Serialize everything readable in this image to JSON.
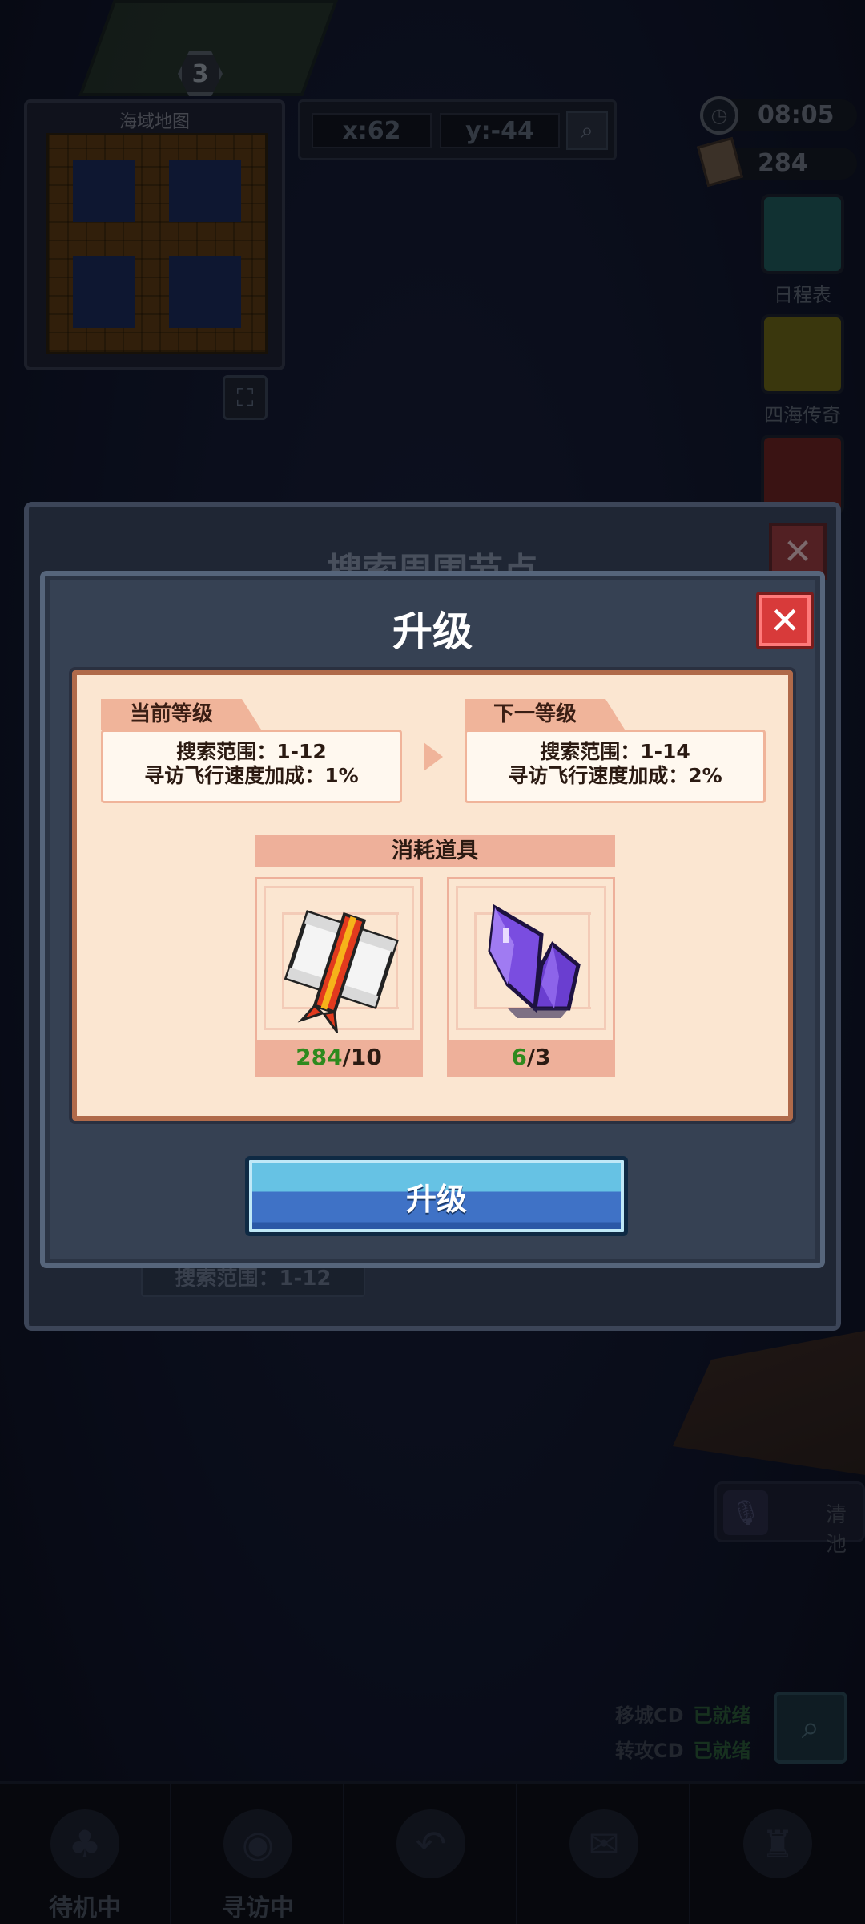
{
  "hud": {
    "base_level": "3",
    "minimap_title": "海域地图",
    "coord_x": "x:62",
    "coord_y": "y:-44",
    "clock": "08:05",
    "scroll_count": "284"
  },
  "side_buttons": [
    {
      "label": "日程表",
      "color": "#1f5a5c"
    },
    {
      "label": "四海传奇",
      "color": "#6b6518"
    },
    {
      "label": "",
      "color": "#6a2424"
    }
  ],
  "background_dialog": {
    "title": "搜索周围节点",
    "range_text": "搜索范围：1-12"
  },
  "upgrade_dialog": {
    "title": "升级",
    "current": {
      "tag": "当前等级",
      "range": "搜索范围：1-12",
      "speed": "寻访飞行速度加成：1%"
    },
    "next": {
      "tag": "下一等级",
      "range": "搜索范围：1-14",
      "speed": "寻访飞行速度加成：2%"
    },
    "consume_header": "消耗道具",
    "items": [
      {
        "name": "scroll-item",
        "have": "284",
        "need": "/10"
      },
      {
        "name": "crystal-item",
        "have": "6",
        "need": "/3"
      }
    ],
    "button": "升级"
  },
  "cooldowns": [
    {
      "label": "移城CD",
      "status": "已就绪"
    },
    {
      "label": "转攻CD",
      "status": "已就绪"
    }
  ],
  "chat_hint": "清池",
  "bottom_tabs": [
    {
      "label": "待机中",
      "icon": "mushroom-icon"
    },
    {
      "label": "寻访中",
      "icon": "cat-icon"
    },
    {
      "label": "",
      "icon": "back-arrow-icon"
    },
    {
      "label": "",
      "icon": "envelope-icon"
    },
    {
      "label": "",
      "icon": "tower-icon"
    }
  ]
}
